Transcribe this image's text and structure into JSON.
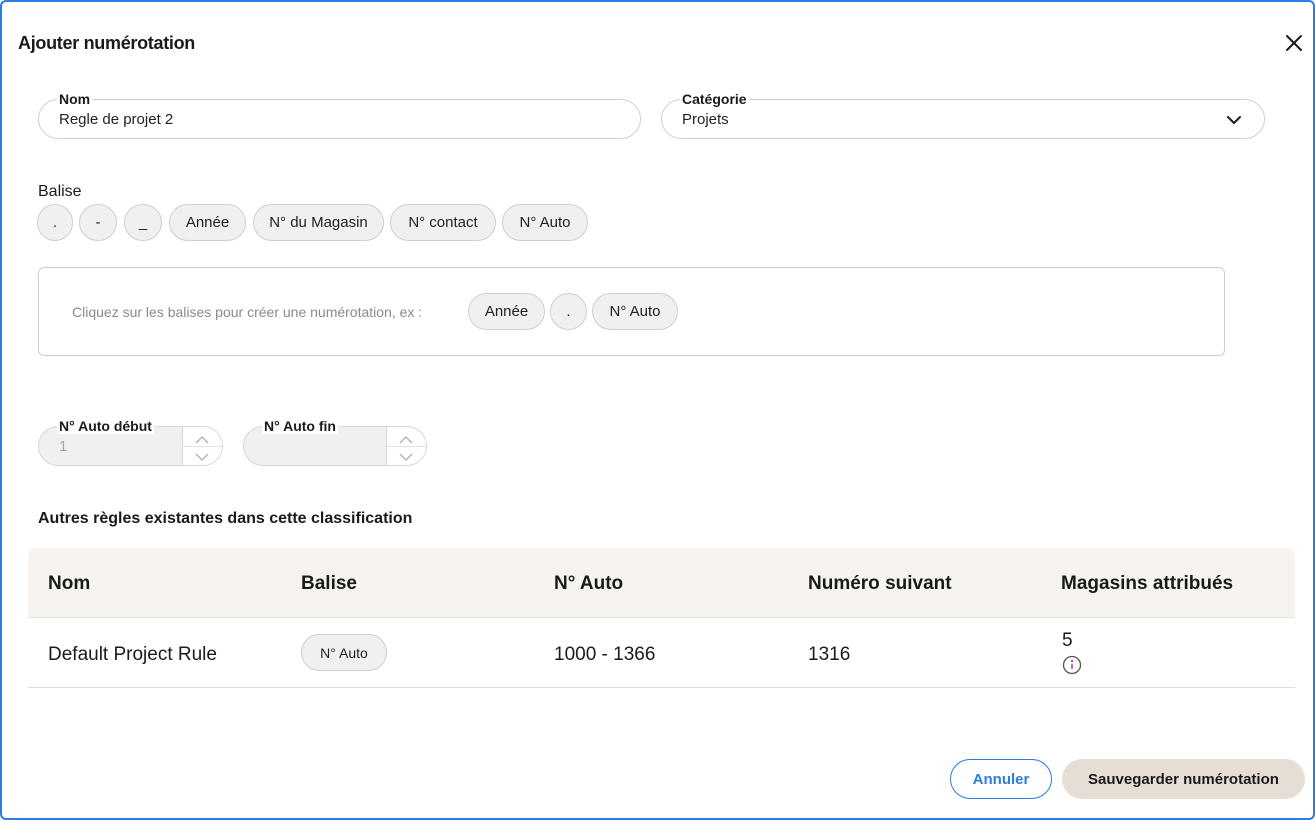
{
  "dialog": {
    "title": "Ajouter numérotation"
  },
  "form": {
    "name": {
      "label": "Nom",
      "value": "Regle de projet 2"
    },
    "category": {
      "label": "Catégorie",
      "value": "Projets"
    },
    "tags_label": "Balise",
    "tags": [
      ".",
      "-",
      "_",
      "Année",
      "N° du Magasin",
      "N° contact",
      "N° Auto"
    ],
    "builder": {
      "hint": "Cliquez sur les balises pour créer une numérotation, ex :",
      "example_tags": [
        "Année",
        ".",
        "N° Auto"
      ]
    },
    "auto_start": {
      "label": "N° Auto début",
      "value": "1"
    },
    "auto_end": {
      "label": "N° Auto fin",
      "value": ""
    }
  },
  "existing_rules": {
    "title": "Autres règles existantes dans cette classification",
    "columns": [
      "Nom",
      "Balise",
      "N° Auto",
      "Numéro suivant",
      "Magasins attribués"
    ],
    "rows": [
      {
        "name": "Default Project Rule",
        "tag": "N° Auto",
        "auto_range": "1000 - 1366",
        "next_number": "1316",
        "stores": "5",
        "info_icon": "info-icon"
      }
    ]
  },
  "actions": {
    "cancel": "Annuler",
    "save": "Sauvegarder numérotation"
  },
  "colors": {
    "border_accent": "#2a7de1",
    "chip_bg": "#f0f0f0",
    "table_header_bg": "#f7f4f0",
    "save_bg": "#e6ddd5",
    "info_icon": "#9b3fd6"
  }
}
